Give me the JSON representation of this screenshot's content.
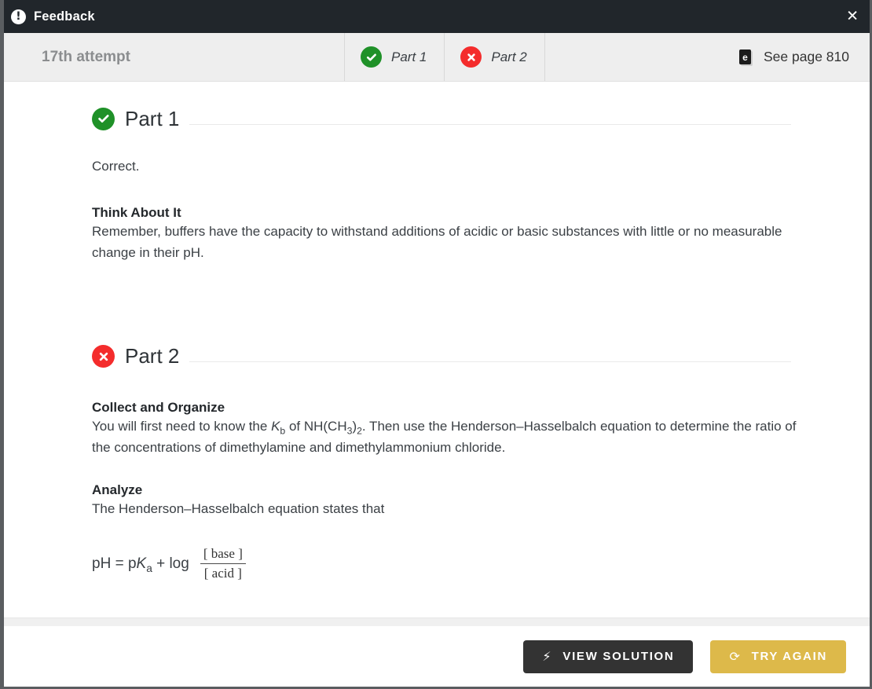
{
  "titlebar": {
    "title": "Feedback",
    "alert_icon": "exclamation-circle-icon",
    "close_icon": "✕"
  },
  "tabbar": {
    "attempt_label": "17th attempt",
    "tabs": [
      {
        "label": "Part 1",
        "status": "correct",
        "icon": "check-circle-icon"
      },
      {
        "label": "Part 2",
        "status": "incorrect",
        "icon": "x-circle-icon"
      }
    ],
    "see_page": {
      "label": "See page 810",
      "icon": "ebook-icon",
      "icon_glyph": "e"
    }
  },
  "content": {
    "part1": {
      "title": "Part 1",
      "status": "correct",
      "result_text": "Correct.",
      "think_about_it": {
        "heading": "Think About It",
        "text": "Remember, buffers have the capacity to withstand additions of acidic or basic substances with little or no measurable change in their pH."
      }
    },
    "part2": {
      "title": "Part 2",
      "status": "incorrect",
      "collect_and_organize": {
        "heading": "Collect and Organize",
        "text_part1": "You will first need to know the ",
        "formula_k": "K",
        "formula_k_sub": "b",
        "text_part2": " of NH(CH",
        "text_sub3": "3",
        "text_part3": ")",
        "text_sub2": "2",
        "text_part4": ". Then use the Henderson–Hasselbalch equation to determine the ratio of the concentrations of dimethylamine and dimethylammonium chloride."
      },
      "analyze": {
        "heading": "Analyze",
        "text": "The Henderson–Hasselbalch equation states that",
        "equation": {
          "lhs_ph": "pH = p",
          "lhs_k": "K",
          "lhs_k_sub": "a",
          "lhs_log": " + log",
          "numerator": "[ base ]",
          "denominator": "[ acid ]"
        }
      }
    }
  },
  "footer": {
    "view_solution": {
      "label": "VIEW SOLUTION",
      "icon": "lightning-bolt-icon",
      "glyph": "⚡"
    },
    "try_again": {
      "label": "TRY AGAIN",
      "icon": "refresh-icon",
      "glyph": "⟳"
    }
  },
  "colors": {
    "titlebar_bg": "#21262b",
    "tabbar_bg": "#eeeeee",
    "success": "#1f9128",
    "error": "#f42c2c",
    "solution_btn": "#333333",
    "retry_btn": "#ddb94a"
  }
}
